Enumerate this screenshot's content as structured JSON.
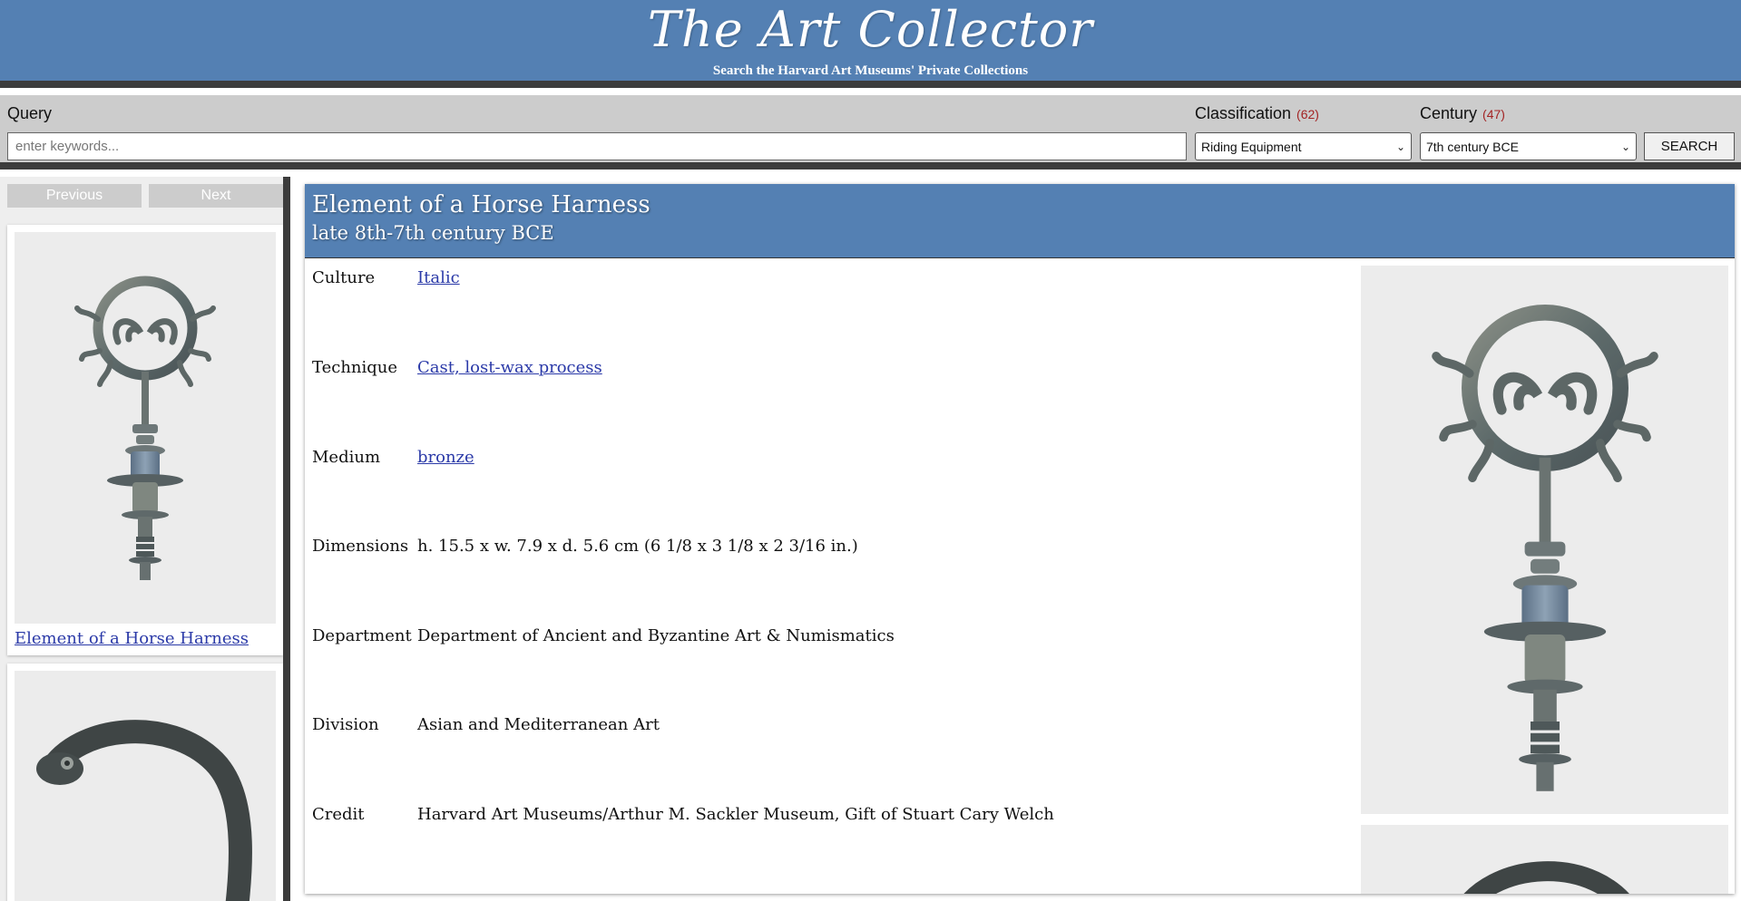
{
  "header": {
    "title": "The Art Collector",
    "subtitle": "Search the Harvard Art Museums' Private Collections"
  },
  "search": {
    "query_label": "Query",
    "query_placeholder": "enter keywords...",
    "classification_label": "Classification",
    "classification_count": "(62)",
    "classification_selected": "Riding Equipment",
    "century_label": "Century",
    "century_count": "(47)",
    "century_selected": "7th century BCE",
    "search_button": "SEARCH"
  },
  "sidebar": {
    "previous_label": "Previous",
    "next_label": "Next",
    "results": [
      {
        "title": "Element of a Horse Harness"
      },
      {
        "title": ""
      }
    ]
  },
  "detail": {
    "title": "Element of a Horse Harness",
    "date": "late 8th-7th century BCE",
    "fields": [
      {
        "label": "Culture",
        "value": "Italic",
        "link": true
      },
      {
        "label": "Technique",
        "value": "Cast, lost-wax process",
        "link": true
      },
      {
        "label": "Medium",
        "value": "bronze",
        "link": true
      },
      {
        "label": "Dimensions",
        "value": "h. 15.5 x w. 7.9 x d. 5.6 cm (6 1/8 x 3 1/8 x 2 3/16 in.)",
        "link": false
      },
      {
        "label": "Department",
        "value": "Department of Ancient and Byzantine Art & Numismatics",
        "link": false
      },
      {
        "label": "Division",
        "value": "Asian and Mediterranean Art",
        "link": false
      },
      {
        "label": "Credit",
        "value": "Harvard Art Museums/Arthur M. Sackler Museum, Gift of Stuart Cary Welch",
        "link": false
      }
    ]
  },
  "colors": {
    "header_blue": "#5480b3",
    "dark_border": "#3c3c3c",
    "link_blue": "#2b3aa8",
    "count_red": "#a32424",
    "bronze_dark": "#5b6366",
    "patina_blue": "#6e8aa6"
  }
}
